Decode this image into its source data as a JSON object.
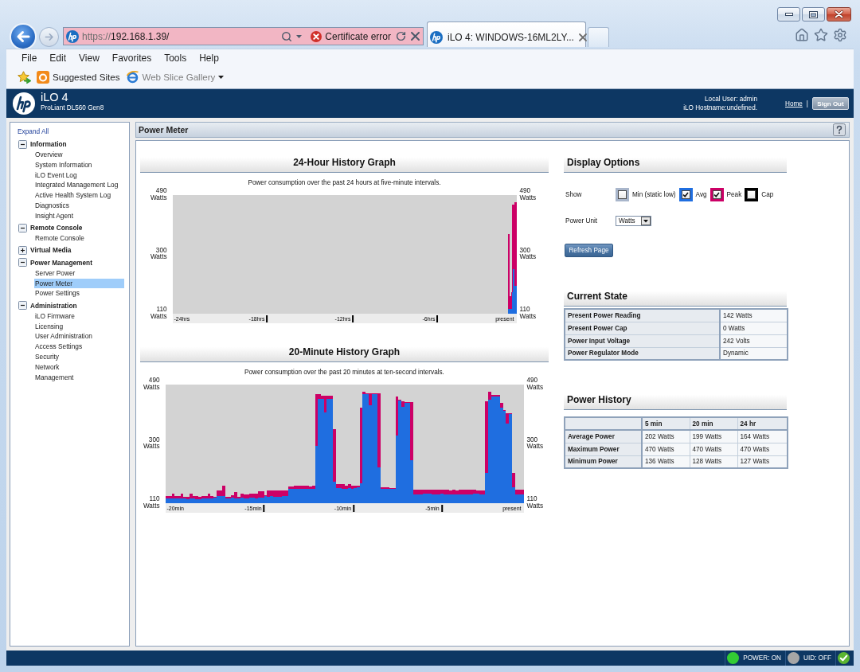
{
  "browser": {
    "nav_buttons": [
      {
        "kind": "back",
        "disabled": false
      },
      {
        "kind": "forward",
        "disabled": true
      }
    ],
    "address": {
      "scheme": "https://",
      "host": "192.168.1.39/",
      "security": "Certificate error"
    },
    "tabs": [
      {
        "title": "iLO 4: WINDOWS-16ML2LY...",
        "selected": true
      }
    ],
    "menu": [
      "File",
      "Edit",
      "View",
      "Favorites",
      "Tools",
      "Help"
    ],
    "favorites": [
      {
        "kind": "site",
        "label": "Suggested Sites",
        "disabled": false
      },
      {
        "kind": "gallery",
        "label": "Web Slice Gallery",
        "disabled": true
      }
    ]
  },
  "header": {
    "product": "iLO 4",
    "model": "ProLiant DL560 Gen8",
    "user": "Local User: admin",
    "hostname": "iLO Hostname:undefined.",
    "home": "Home",
    "separator": "|",
    "sign_out": "Sign Out"
  },
  "sidebar": {
    "expand_all": "Expand All",
    "groups": [
      {
        "label": "Information",
        "expanded": true,
        "children": [
          {
            "label": "Overview",
            "selected": false
          },
          {
            "label": "System Information",
            "selected": false
          },
          {
            "label": "iLO Event Log",
            "selected": false
          },
          {
            "label": "Integrated Management Log",
            "selected": false
          },
          {
            "label": "Active Health System Log",
            "selected": false
          },
          {
            "label": "Diagnostics",
            "selected": false
          },
          {
            "label": "Insight Agent",
            "selected": false
          }
        ]
      },
      {
        "label": "Remote Console",
        "expanded": true,
        "children": [
          {
            "label": "Remote Console",
            "selected": false
          }
        ]
      },
      {
        "label": "Virtual Media",
        "expanded": false
      },
      {
        "label": "Power Management",
        "expanded": true,
        "children": [
          {
            "label": "Server Power",
            "selected": false
          },
          {
            "label": "Power Meter",
            "selected": true
          },
          {
            "label": "Power Settings",
            "selected": false
          }
        ]
      },
      {
        "label": "Administration",
        "expanded": true,
        "children": [
          {
            "label": "iLO Firmware",
            "selected": false
          },
          {
            "label": "Licensing",
            "selected": false
          },
          {
            "label": "User Administration",
            "selected": false
          },
          {
            "label": "Access Settings",
            "selected": false
          },
          {
            "label": "Security",
            "selected": false
          },
          {
            "label": "Network",
            "selected": false
          },
          {
            "label": "Management",
            "selected": false
          }
        ]
      }
    ]
  },
  "page": {
    "title": "Power Meter"
  },
  "graphs": [
    {
      "title": "24-Hour History Graph",
      "caption": "Power consumption over the past 24 hours at five-minute intervals.",
      "chart_data": {
        "type": "area",
        "x": [
          -0.542,
          -0.458,
          -0.375,
          -0.292,
          -0.208,
          -0.125,
          -0.042
        ],
        "xlim": [
          -24,
          0
        ],
        "ylim": [
          110,
          490
        ],
        "xticks": [
          {
            "value": -24,
            "label": "-24hrs"
          },
          {
            "value": -18,
            "label": "-18hrs"
          },
          {
            "value": -12,
            "label": "-12hrs"
          },
          {
            "value": -6,
            "label": "-6hrs"
          },
          {
            "value": 0,
            "label": "present"
          }
        ],
        "yticks": [
          {
            "value": 110,
            "label": "110 Watts"
          },
          {
            "value": 300,
            "label": "300 Watts"
          },
          {
            "value": 490,
            "label": "490 Watts"
          }
        ],
        "stacked": false,
        "series": [
          {
            "color": "#cc0066",
            "values": [
              364,
              166,
              180,
              460,
              460,
              467,
              467
            ]
          },
          {
            "color": "#1f6ee0",
            "values": [
              125,
              125,
              125,
              179,
              254,
              200,
              200
            ]
          }
        ]
      }
    },
    {
      "title": "20-Minute History Graph",
      "caption": "Power consumption over the past 20 minutes at ten-second intervals.",
      "chart_data": {
        "type": "area",
        "x": [
          -19.917,
          -19.75,
          -19.583,
          -19.417,
          -19.25,
          -19.083,
          -18.917,
          -18.75,
          -18.583,
          -18.417,
          -18.25,
          -18.083,
          -17.917,
          -17.75,
          -17.583,
          -17.417,
          -17.25,
          -17.083,
          -16.917,
          -16.75,
          -16.583,
          -16.417,
          -16.25,
          -16.083,
          -15.917,
          -15.75,
          -15.583,
          -15.417,
          -15.25,
          -15.083,
          -14.917,
          -14.75,
          -14.583,
          -14.417,
          -14.25,
          -14.083,
          -13.917,
          -13.75,
          -13.583,
          -13.417,
          -13.25,
          -13.083,
          -12.917,
          -12.75,
          -12.583,
          -12.417,
          -12.25,
          -12.083,
          -11.917,
          -11.75,
          -11.583,
          -11.417,
          -11.25,
          -11.083,
          -10.917,
          -10.75,
          -10.583,
          -10.417,
          -10.25,
          -10.083,
          -9.917,
          -9.75,
          -9.583,
          -9.417,
          -9.25,
          -9.083,
          -8.917,
          -8.75,
          -8.583,
          -8.417,
          -8.25,
          -8.083,
          -7.917,
          -7.75,
          -7.583,
          -7.417,
          -7.25,
          -7.083,
          -6.917,
          -6.75,
          -6.583,
          -6.417,
          -6.25,
          -6.083,
          -5.917,
          -5.75,
          -5.583,
          -5.417,
          -5.25,
          -5.083,
          -4.917,
          -4.75,
          -4.583,
          -4.417,
          -4.25,
          -4.083,
          -3.917,
          -3.75,
          -3.583,
          -3.417,
          -3.25,
          -3.083,
          -2.917,
          -2.75,
          -2.583,
          -2.417,
          -2.25,
          -2.083,
          -1.917,
          -1.75,
          -1.583,
          -1.417,
          -1.25,
          -1.083,
          -0.917,
          -0.75,
          -0.583,
          -0.417,
          -0.25,
          -0.083
        ],
        "xlim": [
          -20,
          0
        ],
        "ylim": [
          110,
          490
        ],
        "xticks": [
          {
            "value": -20,
            "label": "-20min"
          },
          {
            "value": -15,
            "label": "-15min"
          },
          {
            "value": -10,
            "label": "-10min"
          },
          {
            "value": -5,
            "label": "-5min"
          },
          {
            "value": 0,
            "label": "present"
          }
        ],
        "yticks": [
          {
            "value": 110,
            "label": "110 Watts"
          },
          {
            "value": 300,
            "label": "300 Watts"
          },
          {
            "value": 490,
            "label": "490 Watts"
          }
        ],
        "stacked": false,
        "series": [
          {
            "color": "#cc0066",
            "values": [
              132,
              132,
              141,
              132,
              132,
              141,
              131,
              131,
              141,
              132,
              132,
              131,
              132,
              132,
              141,
              133,
              131,
              150,
              150,
              165,
              131,
              131,
              135,
              146,
              131,
              141,
              137,
              137,
              141,
              141,
              141,
              148,
              148,
              135,
              150,
              150,
              150,
              150,
              150,
              150,
              150,
              164,
              164,
              165,
              166,
              165,
              166,
              165,
              164,
              166,
              460,
              460,
              455,
              455,
              455,
              455,
              346,
              170,
              170,
              170,
              167,
              171,
              167,
              167,
              167,
              417,
              468,
              462,
              462,
              462,
              462,
              462,
              160,
              160,
              161,
              159,
              158,
              453,
              442,
              437,
              433,
              433,
              433,
              154,
              154,
              154,
              154,
              154,
              153,
              154,
              154,
              154,
              153,
              153,
              154,
              152,
              154,
              152,
              154,
              154,
              154,
              154,
              153,
              154,
              152,
              152,
              152,
              437,
              468,
              456,
              456,
              456,
              432,
              408,
              399,
              399,
              208,
              154,
              154,
              154
            ]
          },
          {
            "color": "#1f6ee0",
            "values": [
              126,
              126,
              126,
              126,
              125,
              126,
              125,
              124,
              125,
              125,
              124,
              124,
              125,
              125,
              126,
              126,
              128,
              133,
              133,
              133,
              125,
              126,
              127,
              126,
              125,
              127,
              126,
              126,
              127,
              127,
              126,
              128,
              127,
              132,
              130,
              133,
              130,
              130,
              131,
              133,
              133,
              156,
              156,
              157,
              157,
              157,
              156,
              156,
              156,
              156,
              294,
              444,
              444,
              401,
              444,
              444,
              178,
              158,
              158,
              157,
              156,
              158,
              157,
              158,
              160,
              174,
              460,
              460,
              423,
              460,
              460,
              225,
              155,
              155,
              155,
              155,
              155,
              326,
              440,
              419,
              431,
              431,
              249,
              137,
              139,
              138,
              140,
              140,
              140,
              138,
              138,
              138,
              140,
              138,
              137,
              138,
              139,
              139,
              139,
              139,
              139,
              139,
              139,
              140,
              140,
              139,
              138,
              208,
              442,
              453,
              453,
              453,
              416,
              406,
              364,
              395,
              161,
              139,
              139,
              139
            ]
          }
        ]
      }
    }
  ],
  "display_options": {
    "title": "Display Options",
    "show_label": "Show",
    "series": [
      {
        "label": "Min (static low)",
        "checked": false,
        "color": "#a9b6cb"
      },
      {
        "label": "Avg",
        "checked": true,
        "color": "#1f6ee0"
      },
      {
        "label": "Peak",
        "checked": true,
        "color": "#cc0066"
      },
      {
        "label": "Cap",
        "checked": false,
        "color": "#000000"
      }
    ],
    "unit_label": "Power Unit",
    "unit": "Watts",
    "refresh": "Refresh Page"
  },
  "current_state": {
    "title": "Current State",
    "rows": [
      {
        "label": "Present Power Reading",
        "value": "142 Watts"
      },
      {
        "label": "Present Power Cap",
        "value": "0 Watts"
      },
      {
        "label": "Power Input Voltage",
        "value": "242 Volts"
      },
      {
        "label": "Power Regulator Mode",
        "value": "Dynamic"
      }
    ]
  },
  "power_history": {
    "title": "Power History",
    "columns": [
      "5 min",
      "20 min",
      "24 hr"
    ],
    "rows": [
      {
        "label": "Average Power",
        "values": [
          "202 Watts",
          "199 Watts",
          "164 Watts"
        ]
      },
      {
        "label": "Maximum Power",
        "values": [
          "470 Watts",
          "470 Watts",
          "470 Watts"
        ]
      },
      {
        "label": "Minimum Power",
        "values": [
          "136 Watts",
          "128 Watts",
          "127 Watts"
        ]
      }
    ]
  },
  "status_bar": {
    "items": [
      {
        "label": "POWER: ON",
        "color": "#33cc33"
      },
      {
        "label": "UID: OFF",
        "color": "#a6a6a6"
      }
    ]
  }
}
